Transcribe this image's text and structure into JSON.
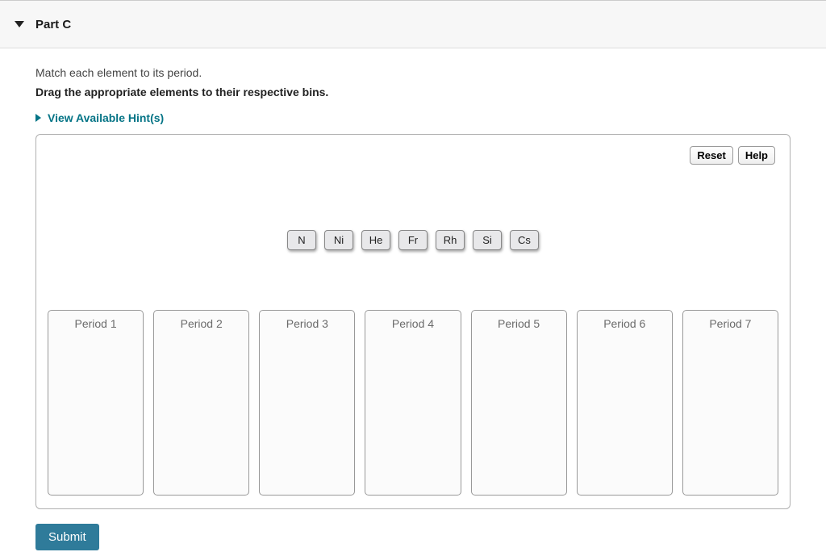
{
  "part": {
    "title": "Part C"
  },
  "prompt": "Match each element to its period.",
  "instructions": "Drag the appropriate elements to their respective bins.",
  "hints": {
    "label": "View Available Hint(s)"
  },
  "toolbar": {
    "reset": "Reset",
    "help": "Help"
  },
  "tiles": [
    {
      "label": "N"
    },
    {
      "label": "Ni"
    },
    {
      "label": "He"
    },
    {
      "label": "Fr"
    },
    {
      "label": "Rh"
    },
    {
      "label": "Si"
    },
    {
      "label": "Cs"
    }
  ],
  "bins": [
    {
      "label": "Period 1"
    },
    {
      "label": "Period 2"
    },
    {
      "label": "Period 3"
    },
    {
      "label": "Period 4"
    },
    {
      "label": "Period 5"
    },
    {
      "label": "Period 6"
    },
    {
      "label": "Period 7"
    }
  ],
  "submit": {
    "label": "Submit"
  }
}
